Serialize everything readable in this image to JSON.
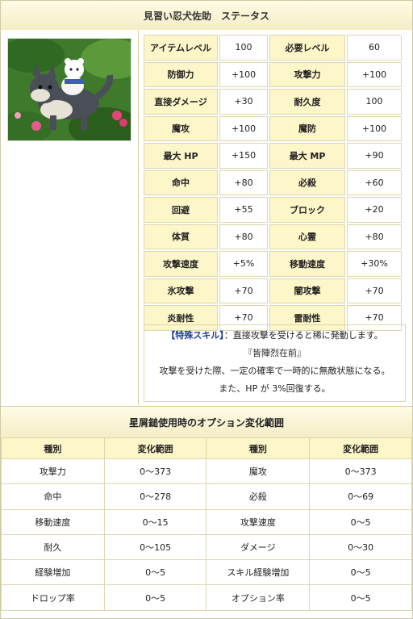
{
  "title": "見習い忍犬佐助　ステータス",
  "pet_image": {
    "icon": "dog-rider-image"
  },
  "stats": [
    [
      "アイテムレベル",
      "100",
      "必要レベル",
      "60"
    ],
    [
      "防御力",
      "+100",
      "攻撃力",
      "+100"
    ],
    [
      "直接ダメージ",
      "+30",
      "耐久度",
      "100"
    ],
    [
      "魔攻",
      "+100",
      "魔防",
      "+100"
    ],
    [
      "最大 HP",
      "+150",
      "最大 MP",
      "+90"
    ],
    [
      "命中",
      "+80",
      "必殺",
      "+60"
    ],
    [
      "回避",
      "+55",
      "ブロック",
      "+20"
    ],
    [
      "体質",
      "+80",
      "心霊",
      "+80"
    ],
    [
      "攻撃速度",
      "+5%",
      "移動速度",
      "+30%"
    ],
    [
      "氷攻撃",
      "+70",
      "闇攻撃",
      "+70"
    ],
    [
      "炎耐性",
      "+70",
      "雷耐性",
      "+70"
    ]
  ],
  "skill": {
    "keyword": "【特殊スキル】",
    "line1": "：直接攻撃を受けると稀に発動します。",
    "line2": "『皆陣烈在前』",
    "line3": "攻撃を受けた際、一定の確率で一時的に無敵状態になる。",
    "line4": "また、HP が 3%回復する。"
  },
  "options_title": "星屑鎚使用時のオプション変化範囲",
  "options_headers": [
    "種別",
    "変化範囲",
    "種別",
    "変化範囲"
  ],
  "options": [
    [
      "攻撃力",
      "0～373",
      "魔攻",
      "0～373"
    ],
    [
      "命中",
      "0～278",
      "必殺",
      "0～69"
    ],
    [
      "移動速度",
      "0～15",
      "攻撃速度",
      "0～5"
    ],
    [
      "耐久",
      "0～105",
      "ダメージ",
      "0～30"
    ],
    [
      "経験増加",
      "0～5",
      "スキル経験増加",
      "0～5"
    ],
    [
      "ドロップ率",
      "0～5",
      "オプション率",
      "0～5"
    ]
  ]
}
